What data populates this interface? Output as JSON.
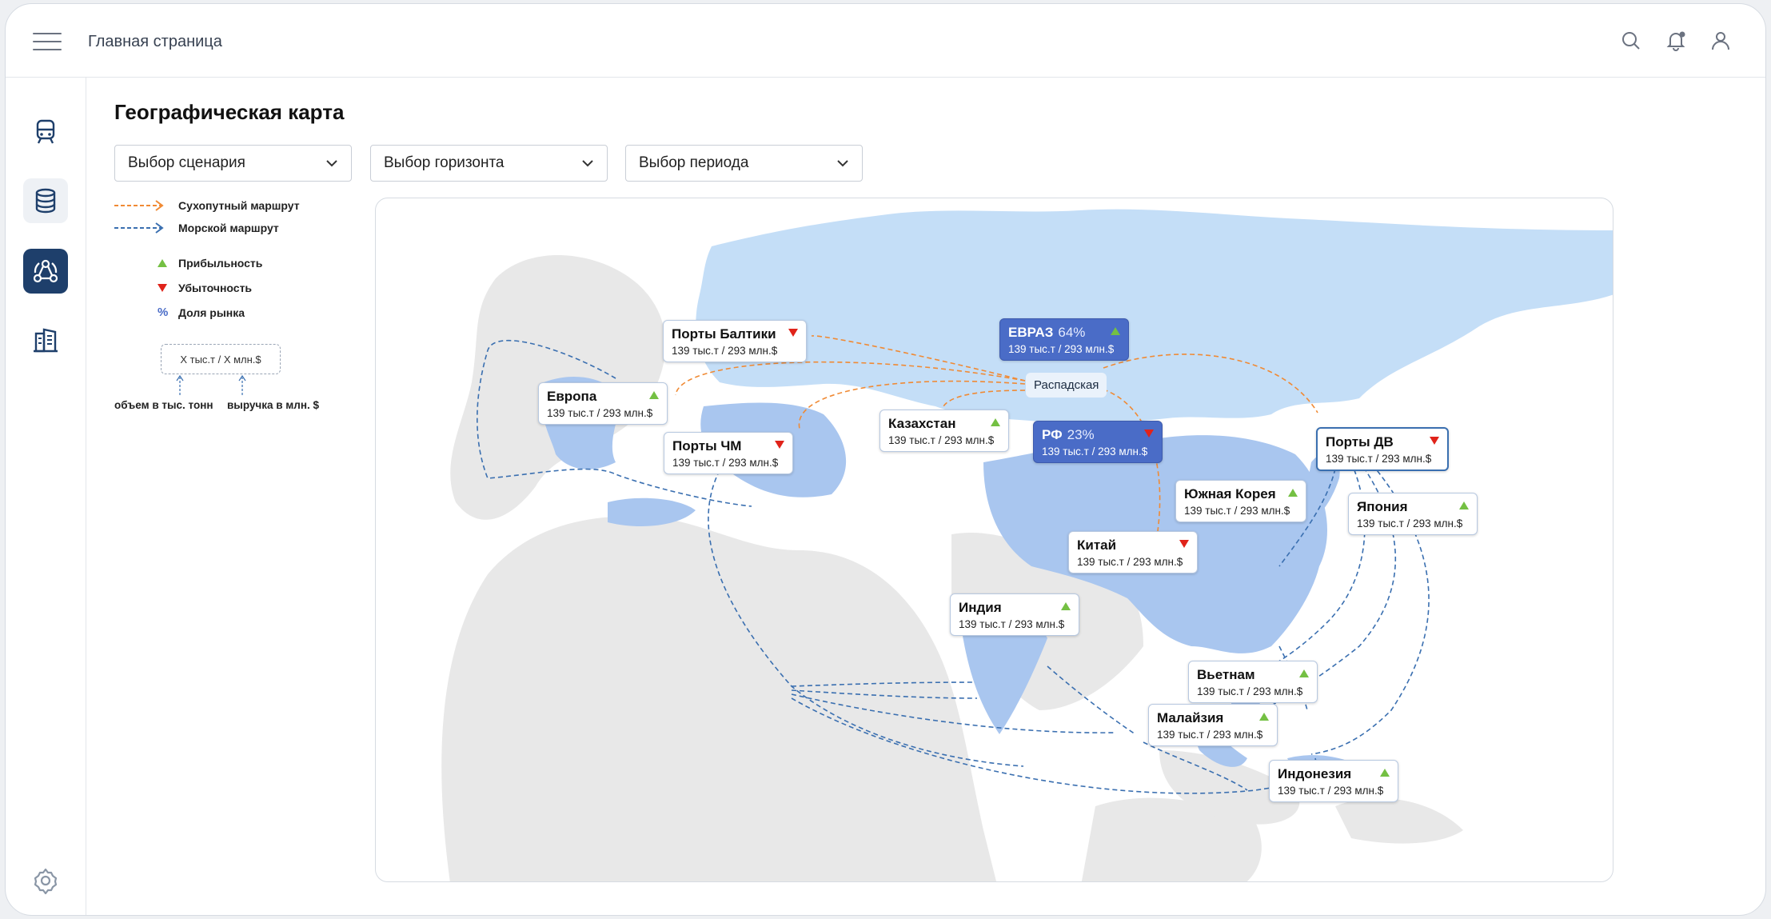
{
  "header": {
    "breadcrumb": "Главная страница"
  },
  "page": {
    "title": "Географическая карта"
  },
  "filters": {
    "scenario": "Выбор сценария",
    "horizon": "Выбор горизонта",
    "period": "Выбор периода"
  },
  "legend": {
    "land_route": "Сухопутный маршрут",
    "sea_route": "Морской маршрут",
    "profit": "Прибыльность",
    "loss": "Убыточность",
    "market_share": "Доля рынка",
    "sample_value": "X тыс.т / X млн.$",
    "volume_caption": "объем в тыс. тонн",
    "revenue_caption": "выручка в млн. $"
  },
  "colors": {
    "land_route": "#f08a34",
    "sea_route": "#3a6fb0",
    "profit": "#74c043",
    "loss": "#e0231a",
    "russia_fill": "#c4def7",
    "partner_fill": "#a9c6ef",
    "other_fill": "#e8e8e8",
    "accent": "#1e3f6b",
    "dark_card": "#4a6cc7"
  },
  "map": {
    "hub_label": "Распадская",
    "nodes": [
      {
        "id": "evraz",
        "name": "ЕВРАЗ",
        "share": "64%",
        "value": "139 тыс.т / 293 млн.$",
        "trend": "up",
        "style": "dark"
      },
      {
        "id": "rf",
        "name": "РФ",
        "share": "23%",
        "value": "139 тыс.т / 293 млн.$",
        "trend": "down",
        "style": "dark"
      },
      {
        "id": "baltic",
        "name": "Порты Балтики",
        "value": "139 тыс.т / 293 млн.$",
        "trend": "down"
      },
      {
        "id": "europe",
        "name": "Европа",
        "value": "139 тыс.т / 293 млн.$",
        "trend": "up"
      },
      {
        "id": "blacksea",
        "name": "Порты ЧМ",
        "value": "139 тыс.т / 293 млн.$",
        "trend": "down"
      },
      {
        "id": "kazakhstan",
        "name": "Казахстан",
        "value": "139 тыс.т / 293 млн.$",
        "trend": "up"
      },
      {
        "id": "fareast",
        "name": "Порты ДВ",
        "value": "139 тыс.т / 293 млн.$",
        "trend": "down"
      },
      {
        "id": "korea",
        "name": "Южная Корея",
        "value": "139 тыс.т / 293 млн.$",
        "trend": "up"
      },
      {
        "id": "japan",
        "name": "Япония",
        "value": "139 тыс.т / 293 млн.$",
        "trend": "up"
      },
      {
        "id": "china",
        "name": "Китай",
        "value": "139 тыс.т / 293 млн.$",
        "trend": "down"
      },
      {
        "id": "india",
        "name": "Индия",
        "value": "139 тыс.т / 293 млн.$",
        "trend": "up"
      },
      {
        "id": "vietnam",
        "name": "Вьетнам",
        "value": "139 тыс.т / 293 млн.$",
        "trend": "up"
      },
      {
        "id": "malaysia",
        "name": "Малайзия",
        "value": "139 тыс.т / 293 млн.$",
        "trend": "up"
      },
      {
        "id": "indonesia",
        "name": "Индонезия",
        "value": "139 тыс.т / 293 млн.$",
        "trend": "up"
      }
    ]
  }
}
